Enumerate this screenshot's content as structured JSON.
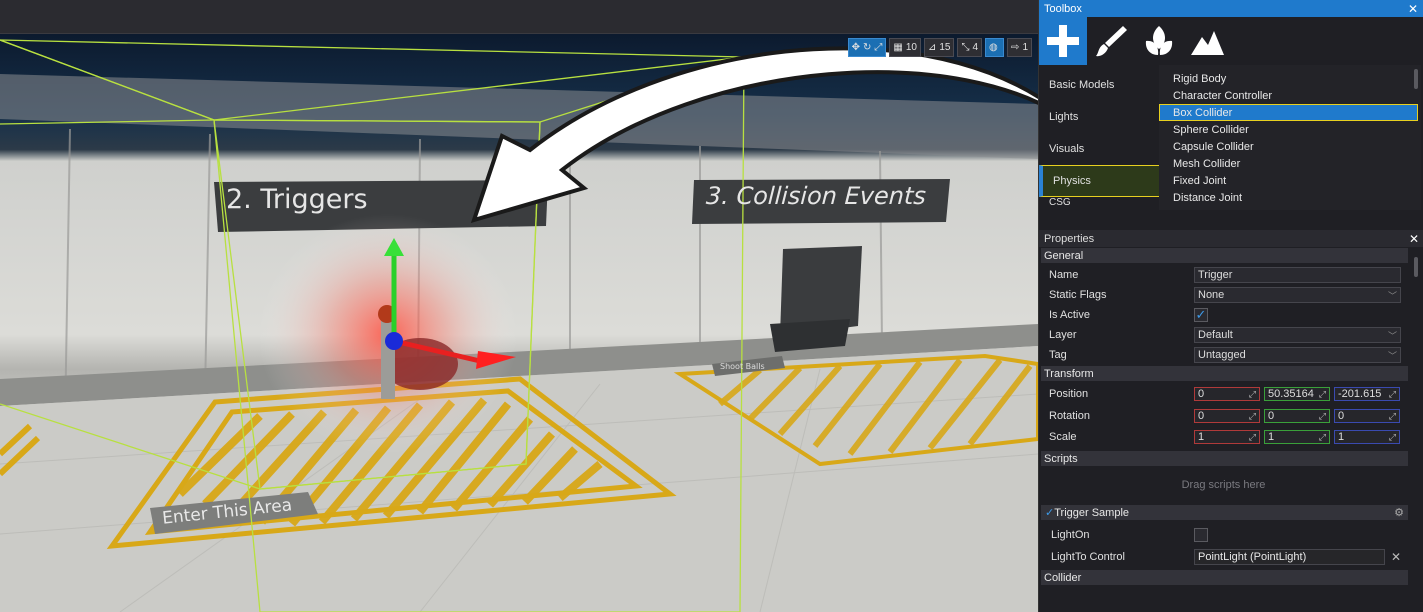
{
  "viewport_toolbar": {
    "grid_value": "10",
    "angle_value": "15",
    "scale_value": "4",
    "speed_value": "1"
  },
  "scene_signs": {
    "triggers": "2. Triggers",
    "collision": "3. Collision Events",
    "enter_area": "Enter This Area",
    "shoot_balls": "Shoot Balls"
  },
  "toolbox": {
    "title": "Toolbox",
    "categories": [
      "Basic Models",
      "Lights",
      "Visuals",
      "Physics",
      "CSG"
    ],
    "active_category": "Physics",
    "items": [
      "Rigid Body",
      "Character Controller",
      "Box Collider",
      "Sphere Collider",
      "Capsule Collider",
      "Mesh Collider",
      "Fixed Joint",
      "Distance Joint"
    ],
    "active_item": "Box Collider"
  },
  "properties": {
    "title": "Properties",
    "general": {
      "header": "General",
      "name_label": "Name",
      "name_value": "Trigger",
      "static_flags_label": "Static Flags",
      "static_flags_value": "None",
      "is_active_label": "Is Active",
      "layer_label": "Layer",
      "layer_value": "Default",
      "tag_label": "Tag",
      "tag_value": "Untagged"
    },
    "transform": {
      "header": "Transform",
      "position_label": "Position",
      "position": [
        "0",
        "50.35164",
        "-201.615"
      ],
      "rotation_label": "Rotation",
      "rotation": [
        "0",
        "0",
        "0"
      ],
      "scale_label": "Scale",
      "scale": [
        "1",
        "1",
        "1"
      ]
    },
    "scripts": {
      "header": "Scripts",
      "drag_hint": "Drag scripts here",
      "script_name": "Trigger Sample",
      "light_on_label": "LightOn",
      "light_to_control_label": "LightTo Control",
      "light_to_control_value": "PointLight (PointLight)"
    },
    "collider_header": "Collider"
  }
}
